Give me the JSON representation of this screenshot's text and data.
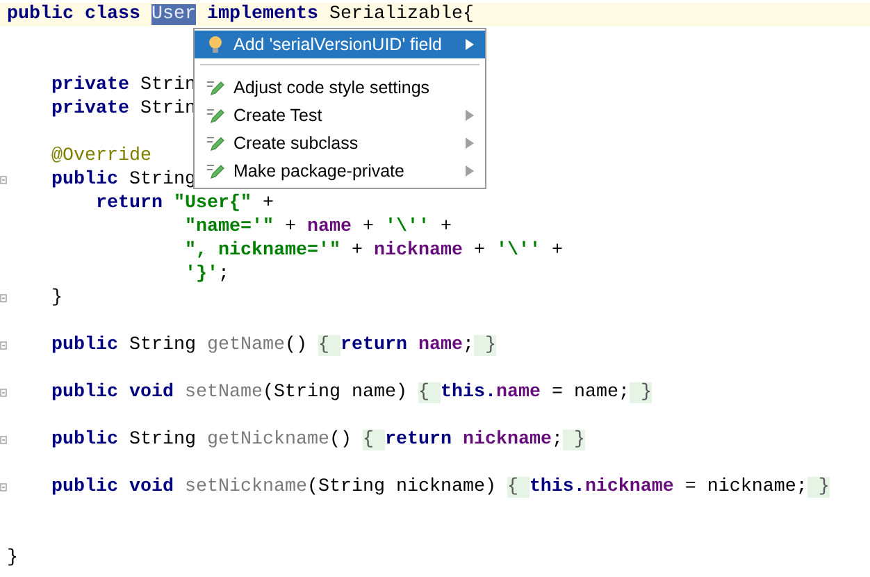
{
  "editor": {
    "lines": [
      {
        "kind": "code",
        "current": true,
        "fold": false,
        "tokens": [
          {
            "kind": "keyword",
            "text": "public class "
          },
          {
            "kind": "selection",
            "text": "User"
          },
          {
            "kind": "keyword",
            "text": " implements"
          },
          {
            "kind": "plain",
            "text": " Serializable{"
          }
        ]
      },
      {
        "kind": "blank"
      },
      {
        "kind": "blank"
      },
      {
        "kind": "code",
        "current": false,
        "fold": false,
        "tokens": [
          {
            "kind": "keyword",
            "text": "    private"
          },
          {
            "kind": "plain",
            "text": " Strin"
          }
        ]
      },
      {
        "kind": "code",
        "current": false,
        "fold": false,
        "tokens": [
          {
            "kind": "keyword",
            "text": "    private"
          },
          {
            "kind": "plain",
            "text": " Strin"
          }
        ]
      },
      {
        "kind": "blank"
      },
      {
        "kind": "code",
        "current": false,
        "fold": false,
        "tokens": [
          {
            "kind": "annotation",
            "text": "    @Override"
          }
        ]
      },
      {
        "kind": "code",
        "current": false,
        "fold": true,
        "tokens": [
          {
            "kind": "keyword",
            "text": "    public"
          },
          {
            "kind": "plain",
            "text": " String"
          }
        ]
      },
      {
        "kind": "code",
        "current": false,
        "fold": false,
        "tokens": [
          {
            "kind": "keyword",
            "text": "        return "
          },
          {
            "kind": "string",
            "text": "\"User{\""
          },
          {
            "kind": "plain",
            "text": " +"
          }
        ]
      },
      {
        "kind": "code",
        "current": false,
        "fold": false,
        "tokens": [
          {
            "kind": "string",
            "text": "                \"name='\""
          },
          {
            "kind": "plain",
            "text": " + "
          },
          {
            "kind": "field",
            "text": "name"
          },
          {
            "kind": "plain",
            "text": " + "
          },
          {
            "kind": "string",
            "text": "'\\''"
          },
          {
            "kind": "plain",
            "text": " +"
          }
        ]
      },
      {
        "kind": "code",
        "current": false,
        "fold": false,
        "tokens": [
          {
            "kind": "string",
            "text": "                \", nickname='\""
          },
          {
            "kind": "plain",
            "text": " + "
          },
          {
            "kind": "field",
            "text": "nickname"
          },
          {
            "kind": "plain",
            "text": " + "
          },
          {
            "kind": "string",
            "text": "'\\''"
          },
          {
            "kind": "plain",
            "text": " +"
          }
        ]
      },
      {
        "kind": "code",
        "current": false,
        "fold": false,
        "tokens": [
          {
            "kind": "string",
            "text": "                '}'"
          },
          {
            "kind": "plain",
            "text": ";"
          }
        ]
      },
      {
        "kind": "code",
        "current": false,
        "fold": true,
        "tokens": [
          {
            "kind": "plain",
            "text": "    }"
          }
        ]
      },
      {
        "kind": "blank"
      },
      {
        "kind": "code",
        "current": false,
        "fold": true,
        "tokens": [
          {
            "kind": "keyword",
            "text": "    public"
          },
          {
            "kind": "plain",
            "text": " String "
          },
          {
            "kind": "method",
            "text": "getName"
          },
          {
            "kind": "plain",
            "text": "() "
          },
          {
            "kind": "folded",
            "text": "{ "
          },
          {
            "kind": "keyword",
            "text": "return "
          },
          {
            "kind": "field",
            "text": "name"
          },
          {
            "kind": "plain",
            "text": ";"
          },
          {
            "kind": "folded",
            "text": " }"
          }
        ]
      },
      {
        "kind": "blank"
      },
      {
        "kind": "code",
        "current": false,
        "fold": true,
        "tokens": [
          {
            "kind": "keyword",
            "text": "    public void "
          },
          {
            "kind": "method",
            "text": "setName"
          },
          {
            "kind": "plain",
            "text": "(String name) "
          },
          {
            "kind": "folded",
            "text": "{ "
          },
          {
            "kind": "keyword",
            "text": "this."
          },
          {
            "kind": "field",
            "text": "name"
          },
          {
            "kind": "plain",
            "text": " = name;"
          },
          {
            "kind": "folded",
            "text": " }"
          }
        ]
      },
      {
        "kind": "blank"
      },
      {
        "kind": "code",
        "current": false,
        "fold": true,
        "tokens": [
          {
            "kind": "keyword",
            "text": "    public"
          },
          {
            "kind": "plain",
            "text": " String "
          },
          {
            "kind": "method",
            "text": "getNickname"
          },
          {
            "kind": "plain",
            "text": "() "
          },
          {
            "kind": "folded",
            "text": "{ "
          },
          {
            "kind": "keyword",
            "text": "return "
          },
          {
            "kind": "field",
            "text": "nickname"
          },
          {
            "kind": "plain",
            "text": ";"
          },
          {
            "kind": "folded",
            "text": " }"
          }
        ]
      },
      {
        "kind": "blank"
      },
      {
        "kind": "code",
        "current": false,
        "fold": true,
        "tokens": [
          {
            "kind": "keyword",
            "text": "    public void "
          },
          {
            "kind": "method",
            "text": "setNickname"
          },
          {
            "kind": "plain",
            "text": "(String nickname) "
          },
          {
            "kind": "folded",
            "text": "{ "
          },
          {
            "kind": "keyword",
            "text": "this."
          },
          {
            "kind": "field",
            "text": "nickname"
          },
          {
            "kind": "plain",
            "text": " = nickname;"
          },
          {
            "kind": "folded",
            "text": " }"
          }
        ]
      },
      {
        "kind": "blank"
      },
      {
        "kind": "blank"
      },
      {
        "kind": "code",
        "current": false,
        "fold": false,
        "tokens": [
          {
            "kind": "plain",
            "text": "}"
          }
        ]
      }
    ]
  },
  "popup": {
    "items": [
      {
        "kind": "intention",
        "label": "Add 'serialVersionUID' field",
        "selected": true,
        "submenu": true
      },
      {
        "kind": "separator"
      },
      {
        "kind": "action",
        "label": "Adjust code style settings",
        "selected": false,
        "submenu": false
      },
      {
        "kind": "action",
        "label": "Create Test",
        "selected": false,
        "submenu": true
      },
      {
        "kind": "action",
        "label": "Create subclass",
        "selected": false,
        "submenu": true
      },
      {
        "kind": "action",
        "label": "Make package-private",
        "selected": false,
        "submenu": true
      }
    ]
  }
}
